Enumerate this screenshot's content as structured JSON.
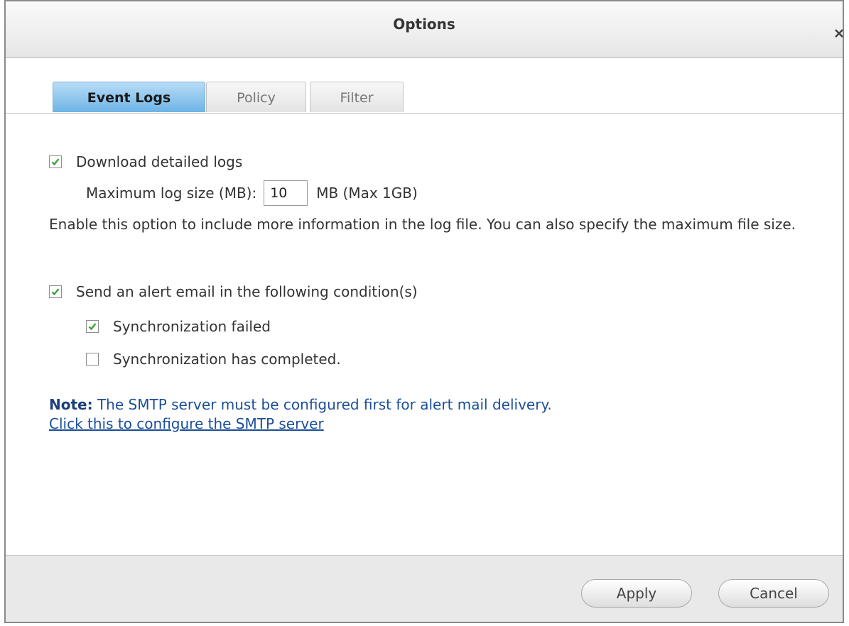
{
  "window": {
    "title": "Options"
  },
  "tabs": [
    {
      "label": "Event Logs",
      "active": true
    },
    {
      "label": "Policy",
      "active": false
    },
    {
      "label": "Filter",
      "active": false
    }
  ],
  "download_logs": {
    "label": "Download detailed logs",
    "checked": true,
    "max_size_label": "Maximum log size (MB):",
    "max_size_value": "10",
    "max_size_suffix": "MB (Max 1GB)"
  },
  "description": "Enable this option to include more information in the log file. You can also specify the maximum file size.",
  "alert": {
    "label": "Send an alert email in the following condition(s)",
    "checked": true,
    "conditions": [
      {
        "label": "Synchronization failed",
        "checked": true
      },
      {
        "label": "Synchronization has completed.",
        "checked": false
      }
    ]
  },
  "note": {
    "prefix": "Note:",
    "text": " The SMTP server must be configured first for alert mail delivery.",
    "link": "Click this to configure the SMTP server"
  },
  "footer": {
    "apply_label": "Apply",
    "cancel_label": "Cancel"
  },
  "colors": {
    "accent_tab": "#6db4e6",
    "checkmark": "#3aa335",
    "note_text": "#1b4f9a"
  }
}
